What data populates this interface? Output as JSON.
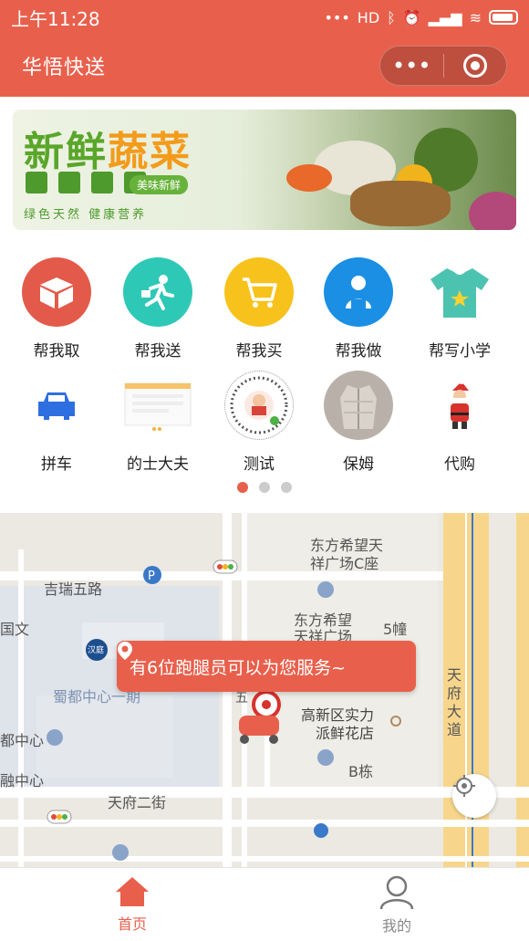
{
  "status": {
    "time": "上午11:28",
    "signal": "HD"
  },
  "navbar": {
    "title": "华悟快送"
  },
  "banner": {
    "title_green": "新鲜",
    "title_orange": "蔬菜",
    "sub": "美味新鲜",
    "slogan": "绿色天然 健康营养"
  },
  "services": [
    {
      "label": "帮我取",
      "color": "#e35a4a",
      "icon": "box-icon"
    },
    {
      "label": "帮我送",
      "color": "#2ec8b6",
      "icon": "runner-icon"
    },
    {
      "label": "帮我买",
      "color": "#f7c21b",
      "icon": "cart-icon"
    },
    {
      "label": "帮我做",
      "color": "#1a8fe3",
      "icon": "worker-icon"
    },
    {
      "label": "帮写小学",
      "color": "#4cc3b0",
      "icon": "tshirt-icon"
    },
    {
      "label": "拼车",
      "color": "#2d6fe0",
      "icon": "car-icon"
    },
    {
      "label": "的士大夫",
      "color": "#f2f2f2",
      "icon": "document-icon"
    },
    {
      "label": "测试",
      "color": "#ffffff",
      "icon": "qrcode-icon"
    },
    {
      "label": "保姆",
      "color": "#b9b1a9",
      "icon": "coat-icon"
    },
    {
      "label": "代购",
      "color": "#ffffff",
      "icon": "santa-icon"
    }
  ],
  "pagination": {
    "pages": 3,
    "active": 1
  },
  "map": {
    "tooltip": "有6位跑腿员可以为您服务~",
    "labels": {
      "east1": "东方希望天",
      "east1b": "祥广场C座",
      "jirui": "吉瑞五路",
      "east2": "东方希望",
      "east2b": "天祥广场",
      "building5": "5幢",
      "wen": "国文",
      "shudu": "蜀都中心一期",
      "gaoxin": "高新区实力",
      "gaoxinb": "派鲜花店",
      "center1": "都中心",
      "bdong": "B栋",
      "center2": "融中心",
      "tianfu2": "天府二街",
      "tianfu_ave": "天府大道",
      "hanting": "汉庭",
      "wu": "五"
    }
  },
  "tabbar": {
    "home": "首页",
    "mine": "我的"
  }
}
